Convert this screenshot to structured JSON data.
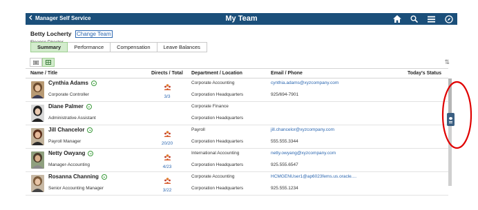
{
  "header": {
    "back_label": "Manager Self Service",
    "title": "My Team",
    "icons": [
      "home-icon",
      "search-icon",
      "menu-icon",
      "navbar-icon"
    ]
  },
  "user": {
    "name": "Betty Locherty",
    "change_label": "Change Team",
    "role": "Finance Director"
  },
  "tabs": [
    {
      "label": "Summary",
      "active": true
    },
    {
      "label": "Performance"
    },
    {
      "label": "Compensation"
    },
    {
      "label": "Leave Balances"
    }
  ],
  "columns": {
    "name": "Name / Title",
    "directs": "Directs / Total",
    "dept": "Department / Location",
    "email": "Email / Phone",
    "status": "Today's Status"
  },
  "rows": [
    {
      "name": "Cynthia Adams",
      "title": "Corporate Controller",
      "directs": "3/3",
      "dept": "Corporate Accounting",
      "location": "Corporation Headquarters",
      "email": "cynthia.adams@xyzcompany.com",
      "phone": "925/694-7901"
    },
    {
      "name": "Diane Palmer",
      "title": "Administrative Assistant",
      "directs": "",
      "dept": "Corporate Finance",
      "location": "Corporation Headquarters",
      "email": "",
      "phone": ""
    },
    {
      "name": "Jill Chancelor",
      "title": "Payroll Manager",
      "directs": "20/20",
      "dept": "Payroll",
      "location": "Corporation Headquarters",
      "email": "jill.chancelor@xyzcompany.com",
      "phone": "555.555.3344"
    },
    {
      "name": "Netty Owyang",
      "title": "Manager-Accounting",
      "directs": "4/23",
      "dept": "International Accounting",
      "location": "Corporation Headquarters",
      "email": "netty.owyang@xyzcompany.com",
      "phone": "925.555.6547"
    },
    {
      "name": "Rosanna Channing",
      "title": "Senior Accounting Manager",
      "directs": "3/22",
      "dept": "Corporate Accounting",
      "location": "Corporation Headquarters",
      "email": "HCMGENUser1@ap6023fems.us.oracle....",
      "phone": "925.555.1234"
    }
  ],
  "colors": {
    "header_bg": "#1b4f7a",
    "active_tab": "#d3eccd",
    "link": "#2a66b0",
    "annotation": "#e00000"
  }
}
